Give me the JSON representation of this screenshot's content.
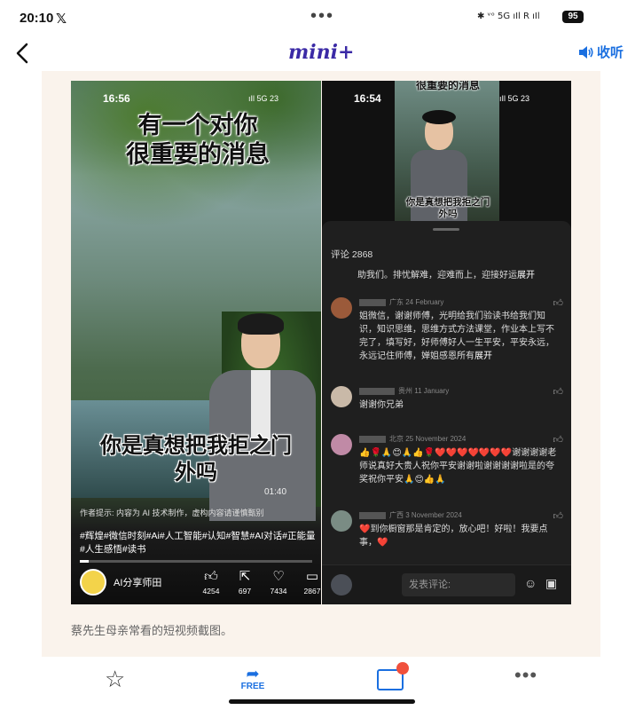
{
  "status_bar": {
    "time": "20:10",
    "app_icon": "x-logo-icon",
    "more": "•••",
    "system": "✱ ᵛᵒ 5G ıIl R ıIl",
    "battery": "95"
  },
  "header": {
    "logo": "mini+",
    "collapse_label": "收听",
    "collapse_icon": "speaker-icon"
  },
  "left_shot": {
    "time": "16:56",
    "signal": "ıIl 5G 23",
    "caption_top": "有一个对你\n很重要的消息",
    "caption_bottom": "你是真想把我拒之门\n外吗",
    "video_time": "01:40",
    "creator_note": "作者提示: 内容为 AI 技术制作，虚构内容请谨慎甄别",
    "hashtags": "#辉煌#微信时刻#Ai#人工智能#认知#智慧#AI对话#正能量#人生感悟#读书",
    "author": "AI分享师田",
    "actions": [
      {
        "icon": "thumbs-up-icon",
        "count": "4254"
      },
      {
        "icon": "share-icon",
        "count": "697"
      },
      {
        "icon": "heart-icon",
        "count": "7434"
      },
      {
        "icon": "comment-icon",
        "count": "2867"
      }
    ],
    "progress": 0.04
  },
  "right_shot": {
    "time": "16:54",
    "signal": "ıIl 5G 23",
    "video_top": "很重要的消息",
    "video_sub": "你是真想把我拒之门\n外吗",
    "comment_count": "评论 2868",
    "truncated": "助我们。排忧解难，迎难而上，迎接好运",
    "expand": "展开",
    "comments": [
      {
        "meta": "广东 24 February",
        "body": "姐微信，谢谢师傅，光明给我们验读书给我们知识，知识思维，思维方式方法课堂，作业本上写不完了，填写好，好师傅好人一生平安，平安永远，永远记住师傅，婵姐感恩所有",
        "expand": "展开"
      },
      {
        "meta": "贵州 11 January",
        "body": "谢谢你兄弟",
        "expand": ""
      },
      {
        "meta": "北京 25 November 2024",
        "body": "👍🌹🙏😊🙏👍🌹❤️❤️❤️❤️❤️❤️❤️谢谢谢谢老师说真好大贵人祝你平安谢谢啦谢谢谢谢啦是的夸奖祝你平安🙏😊👍🙏",
        "expand": ""
      },
      {
        "meta": "广西 3 November 2024",
        "body": "❤️到你橱窗那是肯定的，放心吧！好啦！我要点事，❤️",
        "expand": ""
      }
    ],
    "input_placeholder": "发表评论:"
  },
  "caption": "蔡先生母亲常看的短视频截图。",
  "toolbar": {
    "star_icon": "star-icon",
    "free_label": "FREE",
    "gallery_badge": "",
    "more": "•••"
  }
}
